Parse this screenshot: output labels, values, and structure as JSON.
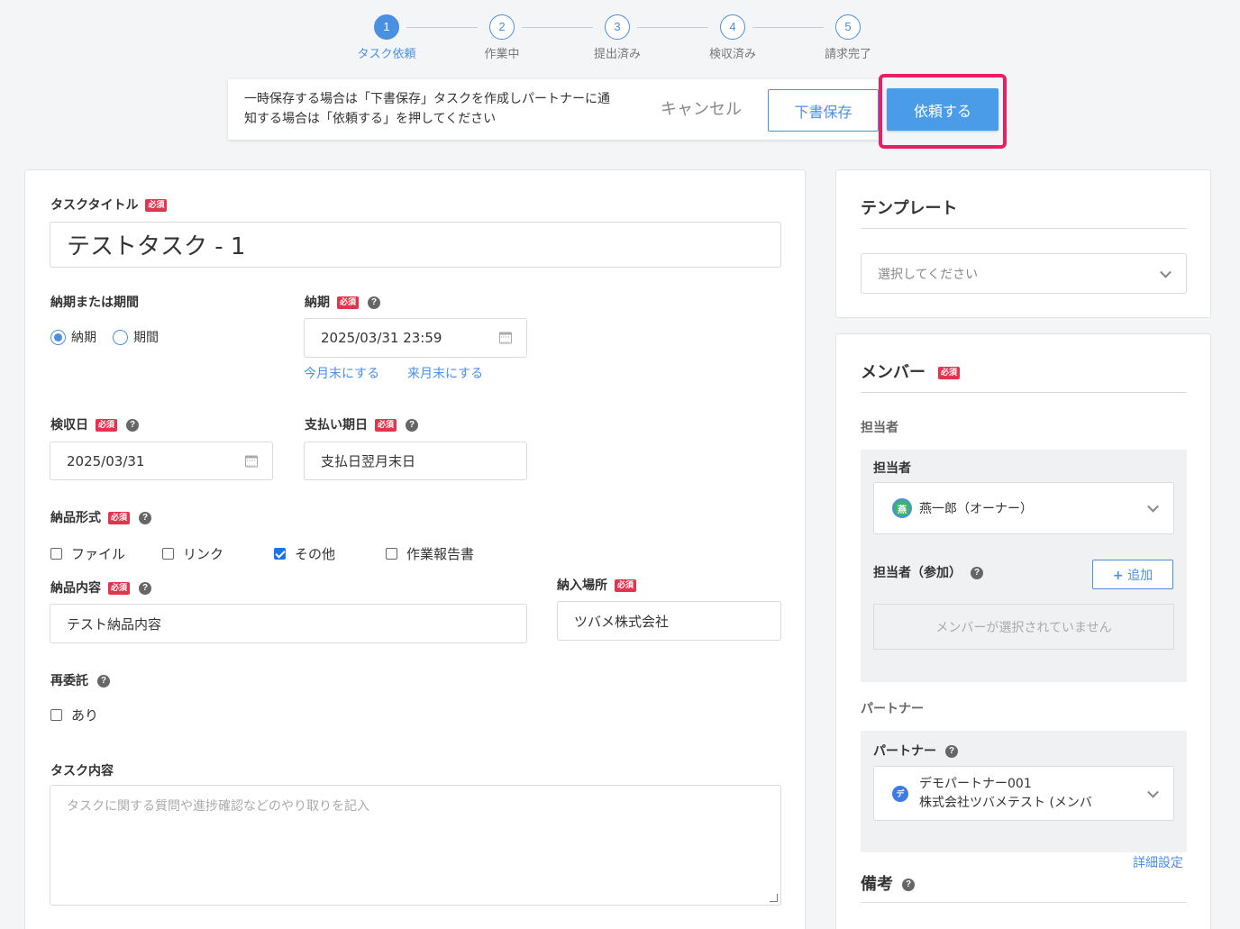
{
  "steps": [
    {
      "num": "1",
      "label": "タスク依頼"
    },
    {
      "num": "2",
      "label": "作業中"
    },
    {
      "num": "3",
      "label": "提出済み"
    },
    {
      "num": "4",
      "label": "検収済み"
    },
    {
      "num": "5",
      "label": "請求完了"
    }
  ],
  "actionbar": {
    "message_line1": "一時保存する場合は「下書保存」タスクを作成しパートナーに通",
    "message_line2": "知する場合は「依頼する」を押してください",
    "cancel": "キャンセル",
    "draft": "下書保存",
    "request": "依頼する"
  },
  "required": "必須",
  "help": "?",
  "form": {
    "title_label": "タスクタイトル",
    "title_value": "テストタスク - 1",
    "deadline_type_label": "納期または期間",
    "radio_deadline": "納期",
    "radio_period": "期間",
    "deadline_label": "納期",
    "deadline_value": "2025/03/31 23:59",
    "link_this_month": "今月末にする",
    "link_next_month": "来月末にする",
    "inspection_label": "検収日",
    "inspection_value": "2025/03/31",
    "payment_label": "支払い期日",
    "payment_value": "支払日翌月末日",
    "delivery_format_label": "納品形式",
    "format_file": "ファイル",
    "format_link": "リンク",
    "format_other": "その他",
    "format_report": "作業報告書",
    "delivery_content_label": "納品内容",
    "delivery_content_value": "テスト納品内容",
    "delivery_place_label": "納入場所",
    "delivery_place_value": "ツバメ株式会社",
    "subcontract_label": "再委託",
    "subcontract_option": "あり",
    "task_content_label": "タスク内容",
    "task_content_placeholder": "タスクに関する質問や進捗確認などのやり取りを記入"
  },
  "template": {
    "title": "テンプレート",
    "placeholder": "選択してください"
  },
  "member": {
    "title": "メンバー",
    "assignee_section": "担当者",
    "assignee_label": "担当者",
    "assignee_avatar": "燕",
    "assignee_value": "燕一郎（オーナー）",
    "participant_label": "担当者（参加）",
    "add_button": "追加",
    "empty_text": "メンバーが選択されていません",
    "partner_section": "パートナー",
    "partner_label": "パートナー",
    "partner_avatar": "デ",
    "partner_name": "デモパートナー001",
    "partner_company": "株式会社ツバメテスト (メンバ",
    "detail_link": "詳細設定",
    "notes_title": "備考"
  },
  "colors": {
    "accent": "#4a90e2",
    "required_badge": "#e5334e",
    "highlight": "#e91e63"
  }
}
